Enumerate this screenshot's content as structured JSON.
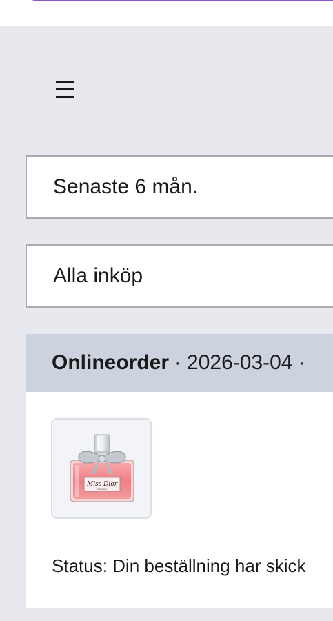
{
  "header": {
    "menu_icon": "hamburger-menu-icon"
  },
  "filters": {
    "period": "Senaste 6 mån.",
    "purchase_type": "Alla inköp"
  },
  "order": {
    "type": "Onlineorder",
    "separator": "·",
    "date": "2026-03-04",
    "product_image": "perfume-bottle-image",
    "product_label": "Miss Dior",
    "product_sublabel": "PARFUM",
    "status": "Status: Din beställning har skick"
  },
  "colors": {
    "page_background": "#e8e9ee",
    "order_header_background": "#ccd2de",
    "accent": "#8a55c9"
  }
}
